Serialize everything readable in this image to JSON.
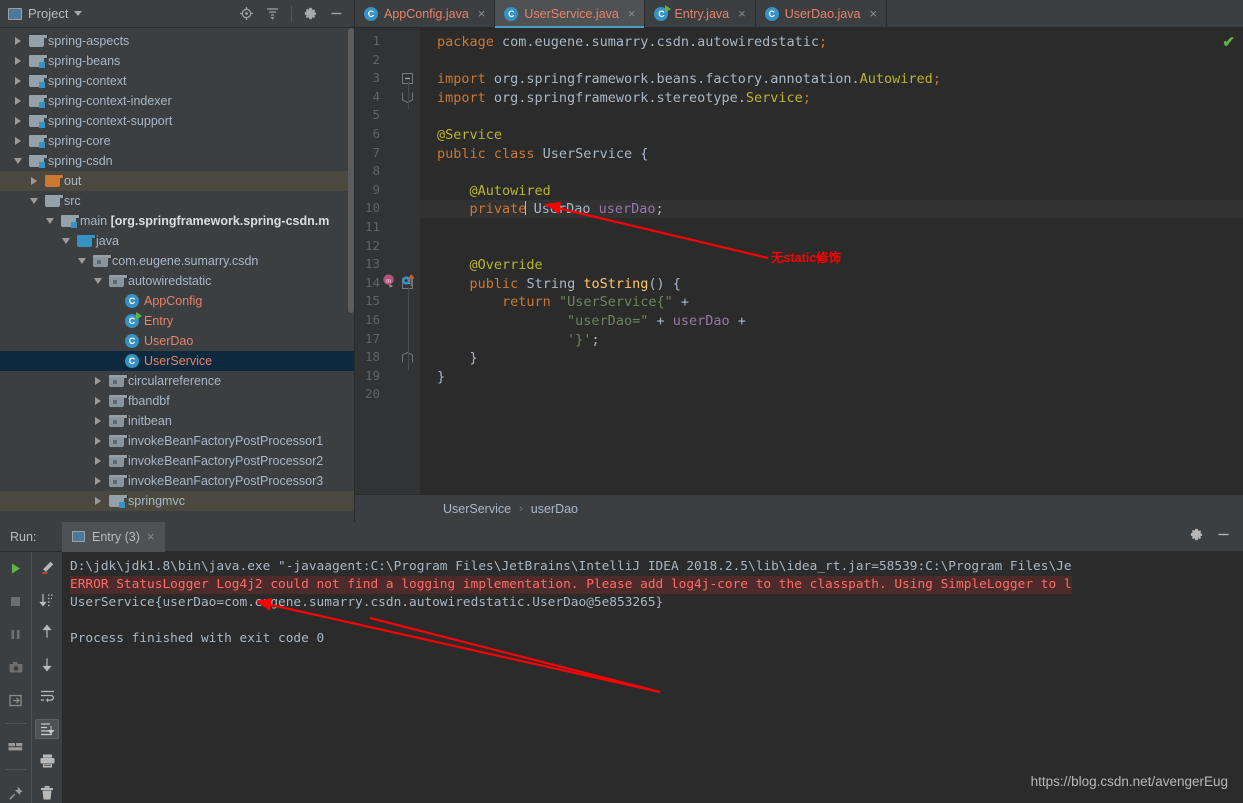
{
  "project_panel": {
    "title": "Project",
    "icons": [
      "locate-icon",
      "collapse-all-icon",
      "gear-icon",
      "minimize-icon"
    ],
    "tree": [
      {
        "label": "spring-aspects",
        "indent": 0,
        "state": "collapsed",
        "icon": "folder-plain",
        "kind": "module"
      },
      {
        "label": "spring-beans",
        "indent": 0,
        "state": "collapsed",
        "icon": "folder-module",
        "kind": "module"
      },
      {
        "label": "spring-context",
        "indent": 0,
        "state": "collapsed",
        "icon": "folder-module",
        "kind": "module"
      },
      {
        "label": "spring-context-indexer",
        "indent": 0,
        "state": "collapsed",
        "icon": "folder-module",
        "kind": "module"
      },
      {
        "label": "spring-context-support",
        "indent": 0,
        "state": "collapsed",
        "icon": "folder-module",
        "kind": "module"
      },
      {
        "label": "spring-core",
        "indent": 0,
        "state": "collapsed",
        "icon": "folder-module",
        "kind": "module"
      },
      {
        "label": "spring-csdn",
        "indent": 0,
        "state": "expanded",
        "icon": "folder-module",
        "kind": "module"
      },
      {
        "label": "out",
        "indent": 1,
        "state": "collapsed",
        "icon": "folder-orange",
        "kind": "folder",
        "hover": true
      },
      {
        "label": "src",
        "indent": 1,
        "state": "expanded",
        "icon": "folder-plain",
        "kind": "folder"
      },
      {
        "label": "main [org.springframework.spring-csdn.m",
        "indent": 2,
        "state": "expanded",
        "icon": "folder-module",
        "kind": "module",
        "bold": true
      },
      {
        "label": "java",
        "indent": 3,
        "state": "expanded",
        "icon": "folder-blue",
        "kind": "source-root"
      },
      {
        "label": "com.eugene.sumarry.csdn",
        "indent": 4,
        "state": "expanded",
        "icon": "folder-package",
        "kind": "package"
      },
      {
        "label": "autowiredstatic",
        "indent": 5,
        "state": "expanded",
        "icon": "folder-package",
        "kind": "package"
      },
      {
        "label": "AppConfig",
        "indent": 6,
        "state": "leaf",
        "icon": "class-icon",
        "kind": "class"
      },
      {
        "label": "Entry",
        "indent": 6,
        "state": "leaf",
        "icon": "class-runnable-icon",
        "kind": "class"
      },
      {
        "label": "UserDao",
        "indent": 6,
        "state": "leaf",
        "icon": "class-icon",
        "kind": "class"
      },
      {
        "label": "UserService",
        "indent": 6,
        "state": "leaf",
        "icon": "class-icon",
        "kind": "class",
        "selected": true
      },
      {
        "label": "circularreference",
        "indent": 5,
        "state": "collapsed",
        "icon": "folder-package",
        "kind": "package"
      },
      {
        "label": "fbandbf",
        "indent": 5,
        "state": "collapsed",
        "icon": "folder-package",
        "kind": "package"
      },
      {
        "label": "initbean",
        "indent": 5,
        "state": "collapsed",
        "icon": "folder-package",
        "kind": "package"
      },
      {
        "label": "invokeBeanFactoryPostProcessor1",
        "indent": 5,
        "state": "collapsed",
        "icon": "folder-package",
        "kind": "package"
      },
      {
        "label": "invokeBeanFactoryPostProcessor2",
        "indent": 5,
        "state": "collapsed",
        "icon": "folder-package",
        "kind": "package"
      },
      {
        "label": "invokeBeanFactoryPostProcessor3",
        "indent": 5,
        "state": "collapsed",
        "icon": "folder-package",
        "kind": "package"
      },
      {
        "label": "springmvc",
        "indent": 5,
        "state": "collapsed",
        "icon": "folder-module",
        "kind": "package",
        "hover": true
      }
    ]
  },
  "editor": {
    "tabs": [
      {
        "label": "AppConfig.java",
        "icon": "class-icon",
        "active": false,
        "close": "×"
      },
      {
        "label": "UserService.java",
        "icon": "class-icon",
        "active": true,
        "close": "×"
      },
      {
        "label": "Entry.java",
        "icon": "class-runnable-icon",
        "active": false,
        "close": "×"
      },
      {
        "label": "UserDao.java",
        "icon": "class-icon",
        "active": false,
        "close": "×"
      }
    ],
    "line_numbers": [
      "1",
      "2",
      "3",
      "4",
      "5",
      "6",
      "7",
      "8",
      "9",
      "10",
      "11",
      "12",
      "13",
      "14",
      "15",
      "16",
      "17",
      "18",
      "19",
      "20"
    ],
    "code_lines": [
      {
        "n": 1,
        "text": "package com.eugene.sumarry.csdn.autowiredstatic;"
      },
      {
        "n": 2,
        "text": ""
      },
      {
        "n": 3,
        "text": "import org.springframework.beans.factory.annotation.Autowired;"
      },
      {
        "n": 4,
        "text": "import org.springframework.stereotype.Service;"
      },
      {
        "n": 5,
        "text": ""
      },
      {
        "n": 6,
        "text": "@Service"
      },
      {
        "n": 7,
        "text": "public class UserService {"
      },
      {
        "n": 8,
        "text": ""
      },
      {
        "n": 9,
        "text": "    @Autowired"
      },
      {
        "n": 10,
        "text": "    private UserDao userDao;",
        "highlighted": true
      },
      {
        "n": 11,
        "text": ""
      },
      {
        "n": 12,
        "text": ""
      },
      {
        "n": 13,
        "text": "    @Override"
      },
      {
        "n": 14,
        "text": "    public String toString() {"
      },
      {
        "n": 15,
        "text": "        return \"UserService{\" +"
      },
      {
        "n": 16,
        "text": "                \"userDao=\" + userDao +"
      },
      {
        "n": 17,
        "text": "                '}';"
      },
      {
        "n": 18,
        "text": "    }"
      },
      {
        "n": 19,
        "text": "}"
      },
      {
        "n": 20,
        "text": ""
      }
    ],
    "gutter_icons": [
      {
        "line": 14,
        "name": "overridden-method-icon"
      },
      {
        "line": 14,
        "name": "implementing-member-icon"
      }
    ],
    "breadcrumb": {
      "class": "UserService",
      "separator": "›",
      "member": "userDao"
    },
    "inspection_status": "✔"
  },
  "annotation": {
    "text": "无static修饰",
    "color": "#ff0000"
  },
  "run_panel": {
    "label": "Run:",
    "tab": {
      "label": "Entry (3)",
      "icon": "run-config-icon",
      "close": "×"
    },
    "header_icons": [
      "gear-icon",
      "minimize-icon"
    ],
    "toolbar_left": [
      "rerun-icon",
      "stop-icon",
      "pause-icon",
      "camera-icon",
      "export-icon",
      "layout-icon",
      "pin-icon"
    ],
    "toolbar_right": [
      "edit-icon",
      "sort-icon",
      "up-icon",
      "down-icon",
      "soft-wrap-icon",
      "scroll-to-end-icon",
      "print-icon",
      "trash-icon"
    ],
    "console_lines": [
      {
        "text": "D:\\jdk\\jdk1.8\\bin\\java.exe \"-javaagent:C:\\Program Files\\JetBrains\\IntelliJ IDEA 2018.2.5\\lib\\idea_rt.jar=58539:C:\\Program Files\\Je",
        "type": "normal"
      },
      {
        "text": "ERROR StatusLogger Log4j2 could not find a logging implementation. Please add log4j-core to the classpath. Using SimpleLogger to l",
        "type": "error"
      },
      {
        "text": "UserService{userDao=com.eugene.sumarry.csdn.autowiredstatic.UserDao@5e853265}",
        "type": "normal"
      },
      {
        "text": "",
        "type": "normal"
      },
      {
        "text": "Process finished with exit code 0",
        "type": "normal"
      }
    ],
    "watermark": "https://blog.csdn.net/avengerEug"
  },
  "colors": {
    "bg_panel": "#3c3f41",
    "bg_editor": "#2b2b2b",
    "accent_blue": "#3592c4",
    "selection": "#0d293e",
    "class_text": "#e8826a",
    "keyword": "#cc7832",
    "string": "#6a8759",
    "annotation_yellow": "#bbb529",
    "error_red": "#ff6b68",
    "arrow_red": "#ff0000",
    "ok_green": "#62b543"
  }
}
